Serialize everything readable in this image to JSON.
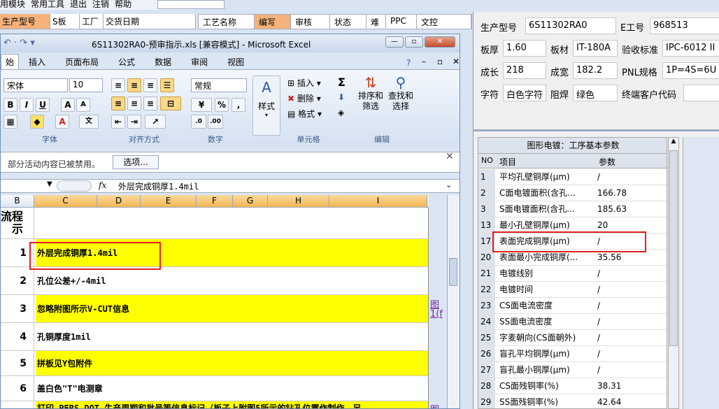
{
  "menubar": {
    "items": [
      "用模块",
      "常用工具",
      "退出",
      "注销",
      "帮助"
    ]
  },
  "toprow": {
    "cells": [
      "生产型号",
      "S板",
      "工厂",
      "交货日期"
    ]
  },
  "procbar": {
    "cells": [
      "工艺名称",
      "编写",
      "审核",
      "状态",
      "难",
      "PPC",
      "文控"
    ]
  },
  "excel": {
    "title": "6S11302RA0-预审指示.xls [兼容模式] - Microsoft Excel",
    "tabs": [
      "始",
      "插入",
      "页面布局",
      "公式",
      "数据",
      "审阅",
      "视图"
    ],
    "font_name": "宋体",
    "font_size": "10",
    "number_format": "常规",
    "buttons": {
      "bold": "B",
      "italic": "I",
      "underline": "U",
      "grow_font": "A",
      "shrink_font": "A",
      "percent": "%",
      "comma": ",",
      "style": "样式",
      "insert": "插入",
      "delete": "删除",
      "format": "格式",
      "sort_filter": "排序和\n筛选",
      "find_select": "查找和\n选择",
      "sigma": "Σ"
    },
    "groups": [
      "字体",
      "对齐方式",
      "数字",
      "单元格",
      "编辑"
    ],
    "message": "部分活动内容已被禁用。",
    "options_button": "选项...",
    "fx_label": "fx",
    "formula": "外层完成铜厚1.4mil",
    "columns": [
      "B",
      "C",
      "D",
      "E",
      "F",
      "G",
      "H",
      "I"
    ],
    "header_cell": "流程\n示",
    "rows": [
      {
        "num": "1",
        "text": "外层完成铜厚1.4mil",
        "yellow": true
      },
      {
        "num": "2",
        "text": "孔位公差+/-4mil",
        "yellow": false
      },
      {
        "num": "3",
        "text": "忽略附图所示V-CUT信息",
        "yellow": true
      },
      {
        "num": "4",
        "text": "孔铜厚度1mil",
        "yellow": false
      },
      {
        "num": "5",
        "text": "拼板见Y包附件",
        "yellow": true
      },
      {
        "num": "6",
        "text": "盖白色\"T\"电测章",
        "yellow": false
      },
      {
        "num": "",
        "text": "打印   PERS DOT 生产周期和批号等信息标记（板子上附图5所示的钻孔位置作制作，另",
        "yellow": true
      }
    ],
    "links": [
      "图",
      "1(f",
      "图"
    ]
  },
  "right_panel": {
    "fields": [
      {
        "label": "生产型号",
        "value": "6S11302RA0"
      },
      {
        "label": "E工号",
        "value": "968513"
      },
      {
        "label": "板厚",
        "value": "1.60"
      },
      {
        "label": "板材",
        "value": "IT-180A"
      },
      {
        "label": "验收标准",
        "value": "IPC-6012 II"
      },
      {
        "label": "成长",
        "value": "218"
      },
      {
        "label": "成宽",
        "value": "182.2"
      },
      {
        "label": "PNL规格",
        "value": "1P=4S=6U"
      },
      {
        "label": "字符",
        "value": "白色字符"
      },
      {
        "label": "阻焊",
        "value": "绿色"
      },
      {
        "label": "终端客户代码",
        "value": ""
      }
    ],
    "table": {
      "title": "图形电镀：工序基本参数",
      "headers": [
        "NO",
        "项目",
        "参数"
      ],
      "rows": [
        {
          "no": "1",
          "item": "平均孔壁铜厚(μm)",
          "param": "/"
        },
        {
          "no": "2",
          "item": "C面电镀面积(含孔...",
          "param": "166.78"
        },
        {
          "no": "3",
          "item": "S面电镀面积(含孔...",
          "param": "185.63"
        },
        {
          "no": "13",
          "item": "最小孔壁铜厚(μm)",
          "param": "20"
        },
        {
          "no": "17",
          "item": "表面完成铜厚(μm)",
          "param": "/"
        },
        {
          "no": "20",
          "item": "表面最小完成铜厚(...",
          "param": "35.56"
        },
        {
          "no": "21",
          "item": "电镀线别",
          "param": "/"
        },
        {
          "no": "22",
          "item": "电镀时间",
          "param": "/"
        },
        {
          "no": "23",
          "item": "CS面电流密度",
          "param": "/"
        },
        {
          "no": "24",
          "item": "SS面电流密度",
          "param": "/"
        },
        {
          "no": "25",
          "item": "字麦朝向(CS面朝外)",
          "param": "/"
        },
        {
          "no": "26",
          "item": "盲孔平均铜厚(μm)",
          "param": "/"
        },
        {
          "no": "27",
          "item": "盲孔最小铜厚(μm)",
          "param": "/"
        },
        {
          "no": "28",
          "item": "CS面残铜率(%)",
          "param": "38.31"
        },
        {
          "no": "29",
          "item": "SS面残铜率(%)",
          "param": "42.64"
        }
      ]
    }
  },
  "colors": {
    "highlight_yellow": "#ffff00",
    "annotation_red": "#e02020",
    "tab_orange": "#f5b37b"
  }
}
